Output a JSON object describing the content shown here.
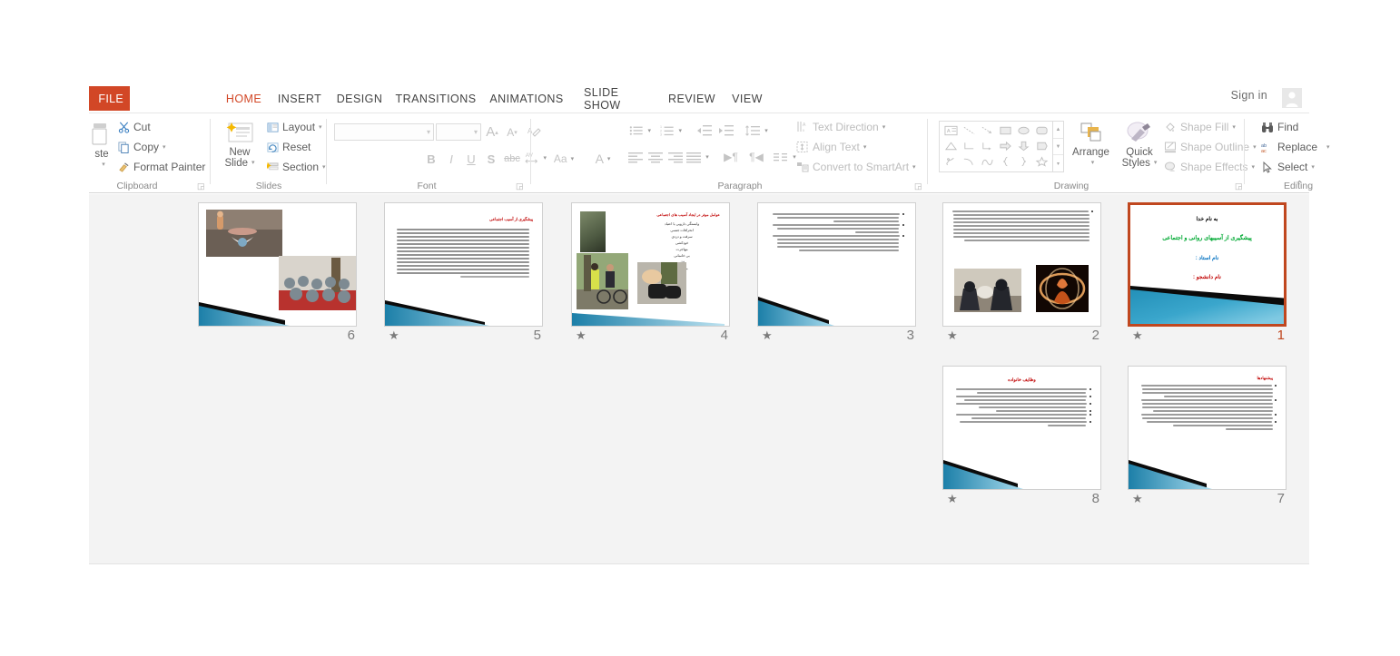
{
  "app": {
    "name": "Microsoft PowerPoint",
    "view": "Slide Sorter"
  },
  "tabs": {
    "file_label": "FILE",
    "items": [
      {
        "label": "HOME",
        "active": true
      },
      {
        "label": "INSERT",
        "active": false
      },
      {
        "label": "DESIGN",
        "active": false
      },
      {
        "label": "TRANSITIONS",
        "active": false
      },
      {
        "label": "ANIMATIONS",
        "active": false
      },
      {
        "label": "SLIDE SHOW",
        "active": false
      },
      {
        "label": "REVIEW",
        "active": false
      },
      {
        "label": "VIEW",
        "active": false
      }
    ],
    "sign_in": "Sign in",
    "avatar_icon": "user-avatar-icon"
  },
  "ribbon": {
    "collapse_icon": "collapse-ribbon-chevron-icon",
    "groups": [
      {
        "name": "Clipboard",
        "label": "Clipboard",
        "dialog_launcher": "clipboard-dialog-launcher",
        "paste_label": "ste",
        "commands": [
          {
            "label": "Cut",
            "icon": "scissors-icon",
            "disabled": false
          },
          {
            "label": "Copy",
            "icon": "copy-icon",
            "disabled": false,
            "caret": true
          },
          {
            "label": "Format Painter",
            "icon": "format-painter-icon",
            "disabled": false
          }
        ]
      },
      {
        "name": "Slides",
        "label": "Slides",
        "new_slide_line1": "New",
        "new_slide_line2": "Slide",
        "new_slide_icon": "new-slide-icon",
        "commands": [
          {
            "label": "Layout",
            "icon": "layout-icon",
            "caret": true
          },
          {
            "label": "Reset",
            "icon": "reset-icon",
            "caret": false
          },
          {
            "label": "Section",
            "icon": "section-icon",
            "caret": true
          }
        ]
      },
      {
        "name": "Font",
        "label": "Font",
        "dialog_launcher": "font-dialog-launcher",
        "font_family_value": "",
        "font_size_value": "",
        "buttons": [
          {
            "name": "increase-font-size",
            "glyph": "A"
          },
          {
            "name": "decrease-font-size",
            "glyph": "A"
          },
          {
            "name": "clear-formatting",
            "glyph": "A"
          },
          {
            "name": "bold",
            "glyph": "B"
          },
          {
            "name": "italic",
            "glyph": "I"
          },
          {
            "name": "underline",
            "glyph": "U"
          },
          {
            "name": "text-shadow",
            "glyph": "S"
          },
          {
            "name": "strikethrough",
            "glyph": "abc"
          },
          {
            "name": "character-spacing",
            "glyph": "AV"
          },
          {
            "name": "change-case",
            "glyph": "Aa"
          },
          {
            "name": "font-color",
            "glyph": "A"
          }
        ]
      },
      {
        "name": "Paragraph",
        "label": "Paragraph",
        "dialog_launcher": "paragraph-dialog-launcher",
        "commands": [
          {
            "label": "Text Direction",
            "icon": "text-direction-icon",
            "caret": true
          },
          {
            "label": "Align Text",
            "icon": "align-text-icon",
            "caret": true
          },
          {
            "label": "Convert to SmartArt",
            "icon": "convert-smartart-icon",
            "caret": true
          }
        ],
        "buttons": [
          "bullets",
          "numbering",
          "decrease-indent",
          "increase-indent",
          "line-spacing",
          "align-left",
          "align-center",
          "align-right",
          "justify",
          "ltr-text-direction",
          "rtl-text-direction",
          "columns"
        ]
      },
      {
        "name": "Drawing",
        "label": "Drawing",
        "dialog_launcher": "drawing-dialog-launcher",
        "arrange_label": "Arrange",
        "arrange_icon": "arrange-icon",
        "quick_styles_line1": "Quick",
        "quick_styles_line2": "Styles",
        "quick_styles_icon": "quick-styles-icon",
        "commands": [
          {
            "label": "Shape Fill",
            "icon": "shape-fill-icon",
            "caret": true,
            "disabled": true
          },
          {
            "label": "Shape Outline",
            "icon": "shape-outline-icon",
            "caret": true,
            "disabled": true
          },
          {
            "label": "Shape Effects",
            "icon": "shape-effects-icon",
            "caret": true,
            "disabled": true
          }
        ],
        "shapes": [
          "textbox-shape",
          "line-shape",
          "arrow-shape",
          "rectangle-shape",
          "oval-shape",
          "rounded-rectangle-shape",
          "triangle-shape",
          "elbow-connector-shape",
          "elbow-arrow-shape",
          "right-arrow-shape",
          "down-arrow-shape",
          "pentagon-shape",
          "scribble-shape",
          "curve-shape",
          "arc-shape",
          "left-brace-shape",
          "right-brace-shape",
          "star-shape"
        ]
      },
      {
        "name": "Editing",
        "label": "Editing",
        "commands": [
          {
            "label": "Find",
            "icon": "find-binoculars-icon",
            "caret": false
          },
          {
            "label": "Replace",
            "icon": "replace-icon",
            "caret": true
          },
          {
            "label": "Select",
            "icon": "select-pointer-icon",
            "caret": true
          }
        ]
      }
    ]
  },
  "sorter": {
    "animation_icon": "animation-star-icon",
    "slides": [
      {
        "number": "6",
        "selected": false,
        "has_animation": false,
        "type": "images-only",
        "deco": true
      },
      {
        "number": "5",
        "selected": false,
        "has_animation": true,
        "type": "title-text",
        "title": "پیشگیری از آسیب اجتماعی",
        "title_color": "#c00000",
        "deco": true
      },
      {
        "number": "4",
        "selected": false,
        "has_animation": true,
        "type": "title-bullets-images",
        "title": "عوامل موثر در ایجاد آسیب های اجتماعی",
        "title_color": "#c00000",
        "bullets": [
          "وابستگی دارویی یا اعتیاد",
          "انحرافات جنسی",
          "سرقت و دزدی",
          "خودکشی",
          "مهاجرت",
          "بی خانمانی",
          "فقر",
          "بزهکاری"
        ],
        "deco": true
      },
      {
        "number": "3",
        "selected": false,
        "has_animation": true,
        "type": "text-only",
        "deco": true
      },
      {
        "number": "2",
        "selected": false,
        "has_animation": true,
        "type": "text-images",
        "deco": false
      },
      {
        "number": "1",
        "selected": true,
        "has_animation": true,
        "type": "title-slide",
        "lines": [
          {
            "text": "به نام خدا",
            "color": "#c00000"
          },
          {
            "text": "پیشگیری از آسیبهای روانی و اجتماعی",
            "color": "#00a933"
          },
          {
            "text": "نام استاد :",
            "color": "#0070c0"
          },
          {
            "text": "نام دانشجو :",
            "color": "#c00000"
          }
        ],
        "deco": true
      },
      {
        "number": "8",
        "selected": false,
        "has_animation": true,
        "type": "title-text",
        "title": "وظایف خانواده",
        "title_color": "#c00000",
        "deco": true
      },
      {
        "number": "7",
        "selected": false,
        "has_animation": true,
        "type": "title-text",
        "title": "پیشنهادها",
        "title_color": "#c00000",
        "deco": true
      }
    ]
  }
}
